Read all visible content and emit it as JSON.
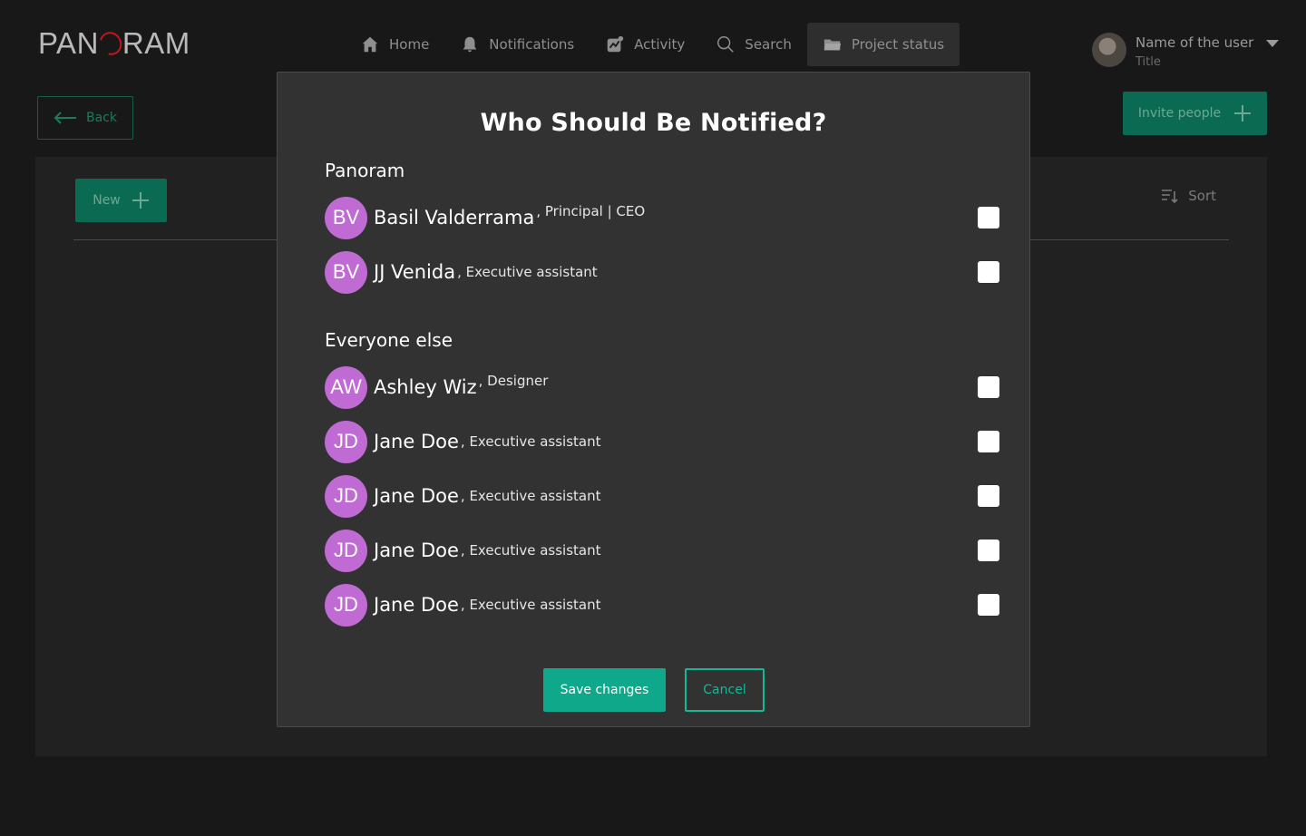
{
  "app": {
    "logo_left": "PAN",
    "logo_right": "RAM"
  },
  "nav": {
    "items": [
      {
        "label": "Home",
        "icon": "home-icon"
      },
      {
        "label": "Notifications",
        "icon": "bell-icon"
      },
      {
        "label": "Activity",
        "icon": "activity-icon"
      },
      {
        "label": "Search",
        "icon": "search-icon"
      },
      {
        "label": "Project status",
        "icon": "folder-icon",
        "active": true
      }
    ]
  },
  "user": {
    "name": "Name of the user",
    "title": "Title"
  },
  "toolbar": {
    "back_label": "Back",
    "invite_label": "Invite people",
    "new_label": "New",
    "sort_label": "Sort"
  },
  "modal": {
    "title": "Who Should Be Notified?",
    "sections": [
      {
        "title": "Panoram",
        "people": [
          {
            "initials": "BV",
            "name": "Basil Valderrama",
            "role": ", Principal | CEO",
            "checked": false
          },
          {
            "initials": "BV",
            "name": "JJ Venida",
            "role": ", Executive assistant",
            "checked": false
          }
        ]
      },
      {
        "title": "Everyone else",
        "people": [
          {
            "initials": "AW",
            "name": "Ashley Wiz",
            "role": ", Designer",
            "checked": false
          },
          {
            "initials": "JD",
            "name": "Jane Doe",
            "role": ", Executive assistant",
            "checked": false
          },
          {
            "initials": "JD",
            "name": "Jane Doe",
            "role": ", Executive assistant",
            "checked": false
          },
          {
            "initials": "JD",
            "name": "Jane Doe",
            "role": ", Executive assistant",
            "checked": false
          },
          {
            "initials": "JD",
            "name": "Jane Doe",
            "role": ", Executive assistant",
            "checked": false
          }
        ]
      }
    ],
    "save_label": "Save changes",
    "cancel_label": "Cancel"
  },
  "colors": {
    "accent": "#10a88a",
    "avatar": "#c06ad3",
    "logo_mark": "#c0161e",
    "modal_bg": "#323232"
  }
}
